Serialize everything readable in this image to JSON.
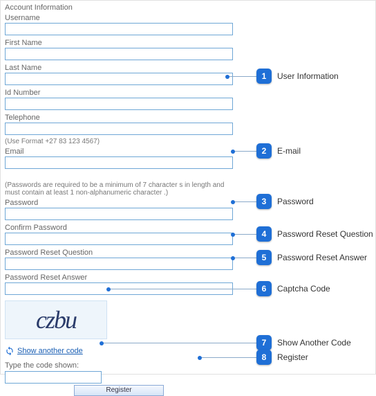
{
  "form": {
    "heading": "Account Information",
    "username_label": "Username",
    "firstname_label": "First Name",
    "lastname_label": "Last Name",
    "idnumber_label": "Id Number",
    "telephone_label": "Telephone",
    "telephone_hint": "(Use Format +27 83 123 4567)",
    "email_label": "Email",
    "password_hint": "(Passwords are required to be a minimum of 7 character s in length and must contain at least 1 non-alphanumeric character .)",
    "password_label": "Password",
    "confirm_password_label": "Confirm Password",
    "reset_question_label": "Password Reset Question",
    "reset_answer_label": "Password Reset Answer",
    "captcha_text": "czbu",
    "show_another_label": "Show another code",
    "type_code_label": "Type the code shown:",
    "register_label": "Register"
  },
  "callouts": {
    "c1": {
      "num": "1",
      "text": "User Information"
    },
    "c2": {
      "num": "2",
      "text": "E-mail"
    },
    "c3": {
      "num": "3",
      "text": "Password"
    },
    "c4": {
      "num": "4",
      "text": "Password Reset Question"
    },
    "c5": {
      "num": "5",
      "text": "Password Reset Answer"
    },
    "c6": {
      "num": "6",
      "text": "Captcha Code"
    },
    "c7": {
      "num": "7",
      "text": "Show Another Code"
    },
    "c8": {
      "num": "8",
      "text": "Register"
    }
  }
}
